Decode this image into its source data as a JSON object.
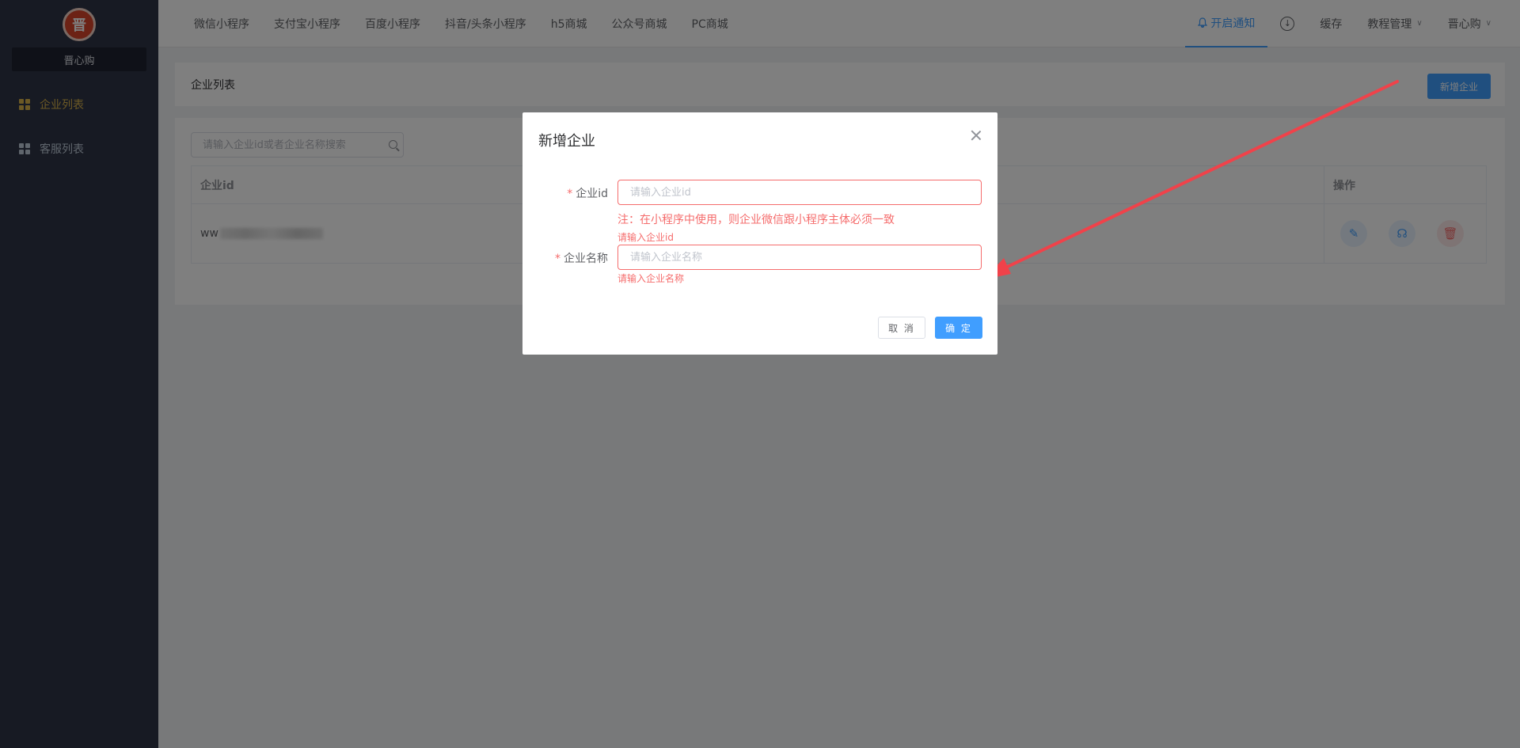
{
  "sidebar": {
    "logo_text": "晋",
    "shop_name": "晋心购",
    "items": [
      {
        "label": "企业列表",
        "active": true
      },
      {
        "label": "客服列表",
        "active": false
      }
    ]
  },
  "header": {
    "nav": [
      "微信小程序",
      "支付宝小程序",
      "百度小程序",
      "抖音/头条小程序",
      "h5商城",
      "公众号商城",
      "PC商城"
    ],
    "notice": "开启通知",
    "cache": "缓存",
    "tutorial": "教程管理",
    "user": "晋心购"
  },
  "page": {
    "title": "企业列表",
    "add_button": "新增企业",
    "search_placeholder": "请输入企业id或者企业名称搜索",
    "table": {
      "columns": [
        "企业id",
        "操作"
      ],
      "rows": [
        {
          "id_prefix": "ww"
        }
      ]
    }
  },
  "dialog": {
    "title": "新增企业",
    "field_id_label": "企业id",
    "field_id_placeholder": "请输入企业id",
    "note": "注：在小程序中使用，则企业微信跟小程序主体必须一致",
    "field_id_error": "请输入企业id",
    "field_name_label": "企业名称",
    "field_name_placeholder": "请输入企业名称",
    "field_name_error": "请输入企业名称",
    "cancel": "取 消",
    "confirm": "确 定"
  },
  "colors": {
    "primary": "#409eff",
    "danger": "#f56c6c",
    "sidebar_bg": "#2f3447",
    "sidebar_active": "#d8b24a",
    "arrow": "#f0424a"
  }
}
